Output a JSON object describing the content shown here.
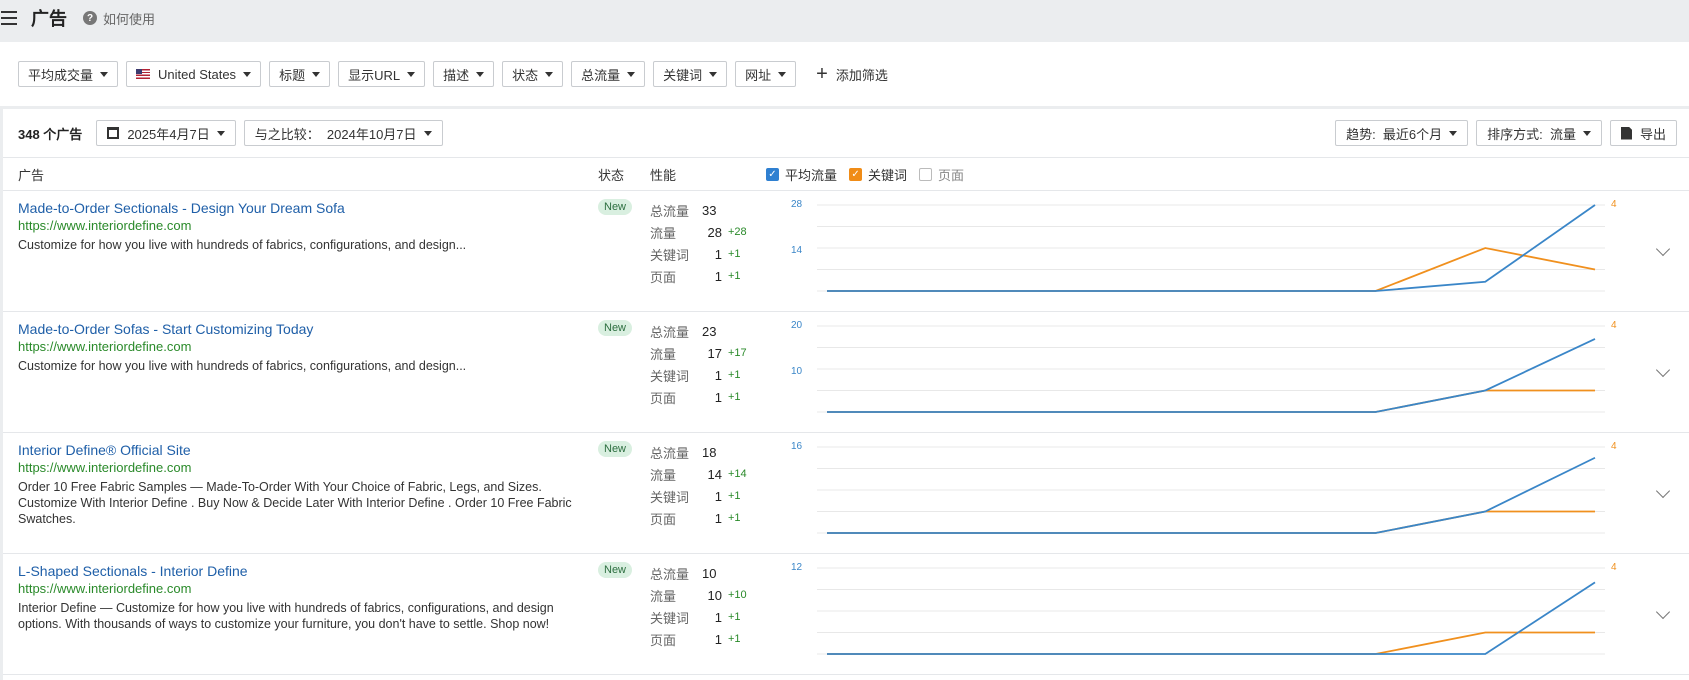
{
  "header": {
    "title": "广告",
    "help_label": "如何使用"
  },
  "filters": {
    "items": [
      "平均成交量",
      "United States",
      "标题",
      "显示URL",
      "描述",
      "状态",
      "总流量",
      "关键词",
      "网址"
    ],
    "add_label": "添加筛选"
  },
  "toolbar": {
    "count_label": "348 个广告",
    "date_label": "2025年4月7日",
    "compare_label": "与之比较：  2024年10月7日",
    "trend_label": "趋势:  最近6个月",
    "sort_label": "排序方式:  流量",
    "export_label": "导出"
  },
  "columns": {
    "ad": "广告",
    "status": "状态",
    "performance": "性能"
  },
  "legend": {
    "avg_traffic": "平均流量",
    "keywords": "关键词",
    "pages": "页面"
  },
  "colors": {
    "traffic": "#3a86c8",
    "keywords": "#f0901e",
    "positive": "#2a8a2a",
    "link": "#1f5fa8"
  },
  "metric_labels": {
    "total": "总流量",
    "traffic": "流量",
    "keywords": "关键词",
    "pages": "页面"
  },
  "ads": [
    {
      "title": "Made-to-Order Sectionals - Design Your Dream Sofa",
      "url": "https://www.interiordefine.com",
      "description": "Customize for how you live with hundreds of fabrics, configurations, and design...",
      "status": "New",
      "total": "33",
      "traffic": "28",
      "traffic_delta": "+28",
      "keywords": "1",
      "keywords_delta": "+1",
      "pages": "1",
      "pages_delta": "+1",
      "chart": {
        "y_max_label": "28",
        "y_mid_label": "14",
        "y_max": 28,
        "kw_max_label": "4",
        "kw_max": 4,
        "traffic": [
          0,
          0,
          0,
          0,
          0,
          0,
          3,
          28
        ],
        "keywords": [
          0,
          0,
          0,
          0,
          0,
          0,
          2,
          1
        ]
      }
    },
    {
      "title": "Made-to-Order Sofas - Start Customizing Today",
      "url": "https://www.interiordefine.com",
      "description": "Customize for how you live with hundreds of fabrics, configurations, and design...",
      "status": "New",
      "total": "23",
      "traffic": "17",
      "traffic_delta": "+17",
      "keywords": "1",
      "keywords_delta": "+1",
      "pages": "1",
      "pages_delta": "+1",
      "chart": {
        "y_max_label": "20",
        "y_mid_label": "10",
        "y_max": 20,
        "kw_max_label": "4",
        "kw_max": 4,
        "traffic": [
          0,
          0,
          0,
          0,
          0,
          0,
          5,
          17
        ],
        "keywords": [
          0,
          0,
          0,
          0,
          0,
          0,
          1,
          1
        ]
      }
    },
    {
      "title": "Interior Define® Official Site",
      "url": "https://www.interiordefine.com",
      "description": "Order 10 Free Fabric Samples — Made-To-Order With Your Choice of Fabric, Legs, and Sizes. Customize With Interior Define . Buy Now & Decide Later With Interior Define . Order 10 Free Fabric Swatches.",
      "status": "New",
      "total": "18",
      "traffic": "14",
      "traffic_delta": "+14",
      "keywords": "1",
      "keywords_delta": "+1",
      "pages": "1",
      "pages_delta": "+1",
      "chart": {
        "y_max_label": "16",
        "y_mid_label": "",
        "y_max": 16,
        "kw_max_label": "4",
        "kw_max": 4,
        "traffic": [
          0,
          0,
          0,
          0,
          0,
          0,
          4,
          14
        ],
        "keywords": [
          0,
          0,
          0,
          0,
          0,
          0,
          1,
          1
        ]
      }
    },
    {
      "title": "L-Shaped Sectionals - Interior Define",
      "url": "https://www.interiordefine.com",
      "description": "Interior Define — Customize for how you live with hundreds of fabrics, configurations, and design options. With thousands of ways to customize your furniture, you don't have to settle. Shop now!",
      "status": "New",
      "total": "10",
      "traffic": "10",
      "traffic_delta": "+10",
      "keywords": "1",
      "keywords_delta": "+1",
      "pages": "1",
      "pages_delta": "+1",
      "chart": {
        "y_max_label": "12",
        "y_mid_label": "",
        "y_max": 12,
        "kw_max_label": "4",
        "kw_max": 4,
        "traffic": [
          0,
          0,
          0,
          0,
          0,
          0,
          0,
          10
        ],
        "keywords": [
          0,
          0,
          0,
          0,
          0,
          0,
          1,
          1
        ]
      }
    }
  ]
}
